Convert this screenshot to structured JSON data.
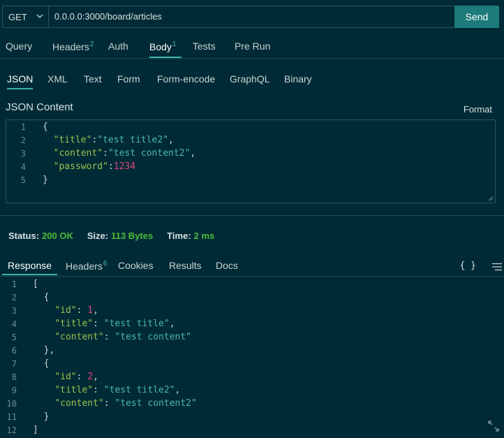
{
  "request": {
    "method": "GET",
    "url": "0.0.0.0:3000/board/articles",
    "send_label": "Send"
  },
  "request_tabs": [
    {
      "label": "Query",
      "badge": ""
    },
    {
      "label": "Headers",
      "badge": "2"
    },
    {
      "label": "Auth",
      "badge": ""
    },
    {
      "label": "Body",
      "badge": "1"
    },
    {
      "label": "Tests",
      "badge": ""
    },
    {
      "label": "Pre Run",
      "badge": ""
    }
  ],
  "body_tabs": [
    "JSON",
    "XML",
    "Text",
    "Form",
    "Form-encode",
    "GraphQL",
    "Binary"
  ],
  "json_content_label": "JSON Content",
  "format_label": "Format",
  "request_body": {
    "line_numbers": [
      "1",
      "2",
      "3",
      "4",
      "5"
    ],
    "lines": [
      [
        {
          "t": "{",
          "c": "p"
        }
      ],
      [
        {
          "t": "  ",
          "c": "p"
        },
        {
          "t": "\"title\"",
          "c": "k"
        },
        {
          "t": ":",
          "c": "p"
        },
        {
          "t": "\"test title2\"",
          "c": "s"
        },
        {
          "t": ",",
          "c": "p"
        }
      ],
      [
        {
          "t": "  ",
          "c": "p"
        },
        {
          "t": "\"content\"",
          "c": "k"
        },
        {
          "t": ":",
          "c": "p"
        },
        {
          "t": "\"test content2\"",
          "c": "s"
        },
        {
          "t": ",",
          "c": "p"
        }
      ],
      [
        {
          "t": "  ",
          "c": "p"
        },
        {
          "t": "\"password\"",
          "c": "k"
        },
        {
          "t": ":",
          "c": "p"
        },
        {
          "t": "1234",
          "c": "n"
        }
      ],
      [
        {
          "t": "}",
          "c": "p"
        }
      ]
    ]
  },
  "status": {
    "status_label": "Status:",
    "status_value": "200 OK",
    "size_label": "Size:",
    "size_value": "113 Bytes",
    "time_label": "Time:",
    "time_value": "2 ms"
  },
  "response_tabs": [
    {
      "label": "Response",
      "badge": ""
    },
    {
      "label": "Headers",
      "badge": "6"
    },
    {
      "label": "Cookies",
      "badge": ""
    },
    {
      "label": "Results",
      "badge": ""
    },
    {
      "label": "Docs",
      "badge": ""
    }
  ],
  "braces_label": "{ }",
  "response_body": {
    "line_numbers": [
      "1",
      "2",
      "3",
      "4",
      "5",
      "6",
      "7",
      "8",
      "9",
      "10",
      "11",
      "12"
    ],
    "lines": [
      [
        {
          "t": "[",
          "c": "p"
        }
      ],
      [
        {
          "t": "  {",
          "c": "p"
        }
      ],
      [
        {
          "t": "    ",
          "c": "p"
        },
        {
          "t": "\"id\"",
          "c": "k"
        },
        {
          "t": ": ",
          "c": "p"
        },
        {
          "t": "1",
          "c": "n"
        },
        {
          "t": ",",
          "c": "p"
        }
      ],
      [
        {
          "t": "    ",
          "c": "p"
        },
        {
          "t": "\"title\"",
          "c": "k"
        },
        {
          "t": ": ",
          "c": "p"
        },
        {
          "t": "\"test title\"",
          "c": "s"
        },
        {
          "t": ",",
          "c": "p"
        }
      ],
      [
        {
          "t": "    ",
          "c": "p"
        },
        {
          "t": "\"content\"",
          "c": "k"
        },
        {
          "t": ": ",
          "c": "p"
        },
        {
          "t": "\"test content\"",
          "c": "s"
        }
      ],
      [
        {
          "t": "  },",
          "c": "p"
        }
      ],
      [
        {
          "t": "  {",
          "c": "p"
        }
      ],
      [
        {
          "t": "    ",
          "c": "p"
        },
        {
          "t": "\"id\"",
          "c": "k"
        },
        {
          "t": ": ",
          "c": "p"
        },
        {
          "t": "2",
          "c": "n"
        },
        {
          "t": ",",
          "c": "p"
        }
      ],
      [
        {
          "t": "    ",
          "c": "p"
        },
        {
          "t": "\"title\"",
          "c": "k"
        },
        {
          "t": ": ",
          "c": "p"
        },
        {
          "t": "\"test title2\"",
          "c": "s"
        },
        {
          "t": ",",
          "c": "p"
        }
      ],
      [
        {
          "t": "    ",
          "c": "p"
        },
        {
          "t": "\"content\"",
          "c": "k"
        },
        {
          "t": ": ",
          "c": "p"
        },
        {
          "t": "\"test content2\"",
          "c": "s"
        }
      ],
      [
        {
          "t": "  }",
          "c": "p"
        }
      ],
      [
        {
          "t": "]",
          "c": "p"
        }
      ]
    ]
  },
  "colors": {
    "background": "#002b36",
    "accent": "#1d7b7b",
    "key": "#9bc14b",
    "string": "#4db8a8",
    "number": "#e0457b",
    "status_ok": "#4dbb3a"
  }
}
